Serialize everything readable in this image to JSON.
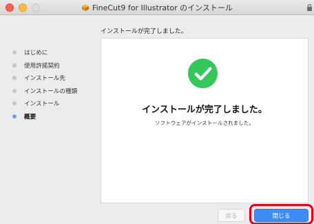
{
  "window": {
    "title": "FineCut9 for Illustrator のインストール",
    "icon": "finecut-app-icon"
  },
  "header": {
    "message": "インストールが完了しました。"
  },
  "steps": [
    {
      "label": "はじめに",
      "active": false
    },
    {
      "label": "使用許諾契約",
      "active": false
    },
    {
      "label": "インストール先",
      "active": false
    },
    {
      "label": "インストールの種類",
      "active": false
    },
    {
      "label": "インストール",
      "active": false
    },
    {
      "label": "概要",
      "active": true
    }
  ],
  "content": {
    "icon": "success-check-icon",
    "title": "インストールが完了しました。",
    "subtitle": "ソフトウェアがインストールされました。"
  },
  "buttons": {
    "back_label": "戻る",
    "close_label": "閉じる"
  },
  "colors": {
    "accent": "#3f8cf6",
    "success": "#34c759",
    "highlight": "#e3001b",
    "active_step_dot": "#6aa0f7"
  }
}
